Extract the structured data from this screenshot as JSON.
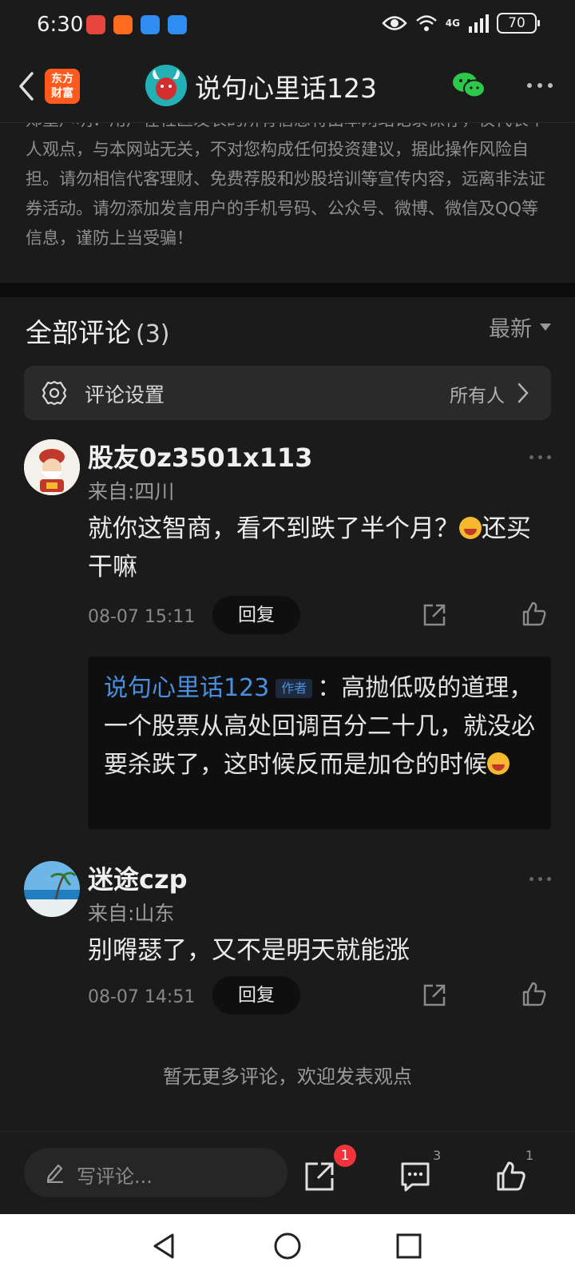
{
  "status_bar": {
    "time": "6:30",
    "network": "4G",
    "battery": "70",
    "app_icon_colors": [
      "#e8463c",
      "#ff6a1e",
      "#2f8cf0",
      "#2f8cf0"
    ]
  },
  "header": {
    "brand_line1": "东方",
    "brand_line2": "财富",
    "title": "说句心里话123",
    "accent_color": "#ff5a1e"
  },
  "disclaimer": {
    "text": "郑重声明：用户在社区发表的所有信息将由本网站记录保存，仅代表个人观点，与本网站无关，不对您构成任何投资建议，据此操作风险自担。请勿相信代客理财、免费荐股和炒股培训等宣传内容，远离非法证券活动。请勿添加发言用户的手机号码、公众号、微博、微信及QQ等信息，谨防上当受骗！"
  },
  "comments_section": {
    "title": "全部评论",
    "count": "(3)",
    "sort_label": "最新",
    "settings_label": "评论设置",
    "settings_value": "所有人",
    "no_more": "暂无更多评论，欢迎发表观点"
  },
  "comments": [
    {
      "user": "股友0z3501x113",
      "from": "来自:四川",
      "text_before_emoji": "就你这智商，看不到跌了半个月？",
      "text_after_emoji": "还买干嘛",
      "time": "08-07 15:11",
      "reply_label": "回复",
      "sub_reply": {
        "user": "说句心里话123",
        "badge": "作者",
        "text": "：高抛低吸的道理，一个股票从高处回调百分二十几，就没必要杀跌了，这时候反而是加仓的时候"
      }
    },
    {
      "user": "迷途czp",
      "from": "来自:山东",
      "text": "别嘚瑟了，又不是明天就能涨",
      "time": "08-07 14:51",
      "reply_label": "回复"
    }
  ],
  "bottom_bar": {
    "write_placeholder": "写评论...",
    "share_badge": "1",
    "comment_count": "3",
    "like_count": "1"
  },
  "icons": {
    "back": "back-arrow-icon",
    "wechat": "wechat-icon",
    "more": "more-icon",
    "gear": "gear-icon",
    "share": "share-icon",
    "like": "thumbs-up-icon",
    "pen": "pen-icon",
    "comment": "comment-icon"
  }
}
